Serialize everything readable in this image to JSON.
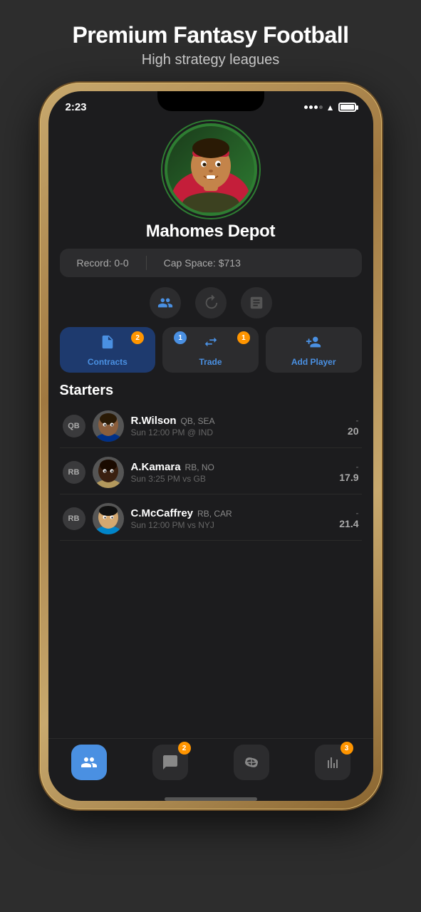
{
  "hero": {
    "title": "Premium Fantasy Football",
    "subtitle": "High strategy leagues"
  },
  "status_bar": {
    "time": "2:23"
  },
  "team": {
    "name": "Mahomes Depot",
    "record": "Record: 0-0",
    "cap_space": "Cap Space: $713"
  },
  "icon_tabs": [
    {
      "name": "roster-icon",
      "symbol": "👥"
    },
    {
      "name": "history-icon",
      "symbol": "🕐"
    },
    {
      "name": "notes-icon",
      "symbol": "📋"
    }
  ],
  "action_buttons": [
    {
      "name": "contracts-button",
      "label": "Contracts",
      "badge_right": "2",
      "badge_right_color": "orange",
      "active": true
    },
    {
      "name": "trade-button",
      "label": "Trade",
      "badge_left": "1",
      "badge_left_color": "blue",
      "badge_right": "1",
      "badge_right_color": "orange",
      "active": false
    },
    {
      "name": "add-player-button",
      "label": "Add Player",
      "active": false
    }
  ],
  "sections": {
    "starters_label": "Starters"
  },
  "players": [
    {
      "position": "QB",
      "name": "R.Wilson",
      "pos_team": "QB, SEA",
      "game": "Sun 12:00 PM @ IND",
      "score_dash": "-",
      "score": "20"
    },
    {
      "position": "RB",
      "name": "A.Kamara",
      "pos_team": "RB, NO",
      "game": "Sun 3:25 PM vs GB",
      "score_dash": "-",
      "score": "17.9"
    },
    {
      "position": "RB",
      "name": "C.McCaffrey",
      "pos_team": "RB, CAR",
      "game": "Sun 12:00 PM vs NYJ",
      "score_dash": "-",
      "score": "21.4"
    }
  ],
  "bottom_tabs": [
    {
      "name": "roster-tab",
      "symbol": "👥",
      "active": true,
      "badge": null
    },
    {
      "name": "chat-tab",
      "symbol": "💬",
      "active": false,
      "badge": "2"
    },
    {
      "name": "football-tab",
      "symbol": "🏈",
      "active": false,
      "badge": null
    },
    {
      "name": "stats-tab",
      "symbol": "📊",
      "active": false,
      "badge": "3"
    }
  ]
}
